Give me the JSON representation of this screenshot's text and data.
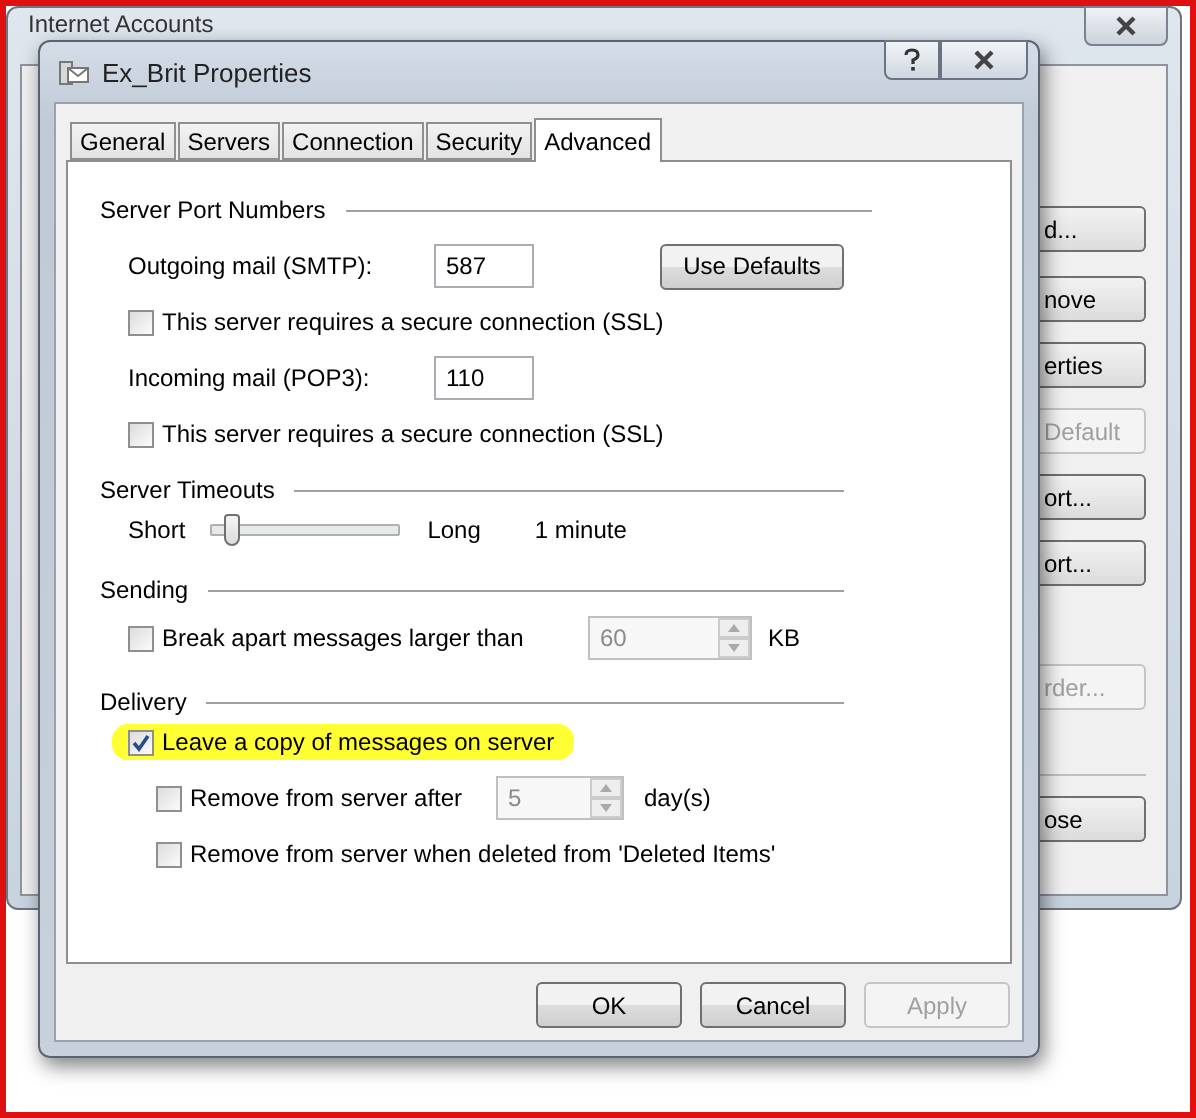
{
  "background_window": {
    "title": "Internet Accounts",
    "buttons": [
      {
        "label": "d...",
        "disabled": false
      },
      {
        "label": "nove",
        "disabled": false
      },
      {
        "label": "erties",
        "disabled": false
      },
      {
        "label": "Default",
        "disabled": true
      },
      {
        "label": "ort...",
        "disabled": false
      },
      {
        "label": "ort...",
        "disabled": false
      },
      {
        "label": "rder...",
        "disabled": true
      },
      {
        "label": "ose",
        "disabled": false
      }
    ]
  },
  "dialog": {
    "title": "Ex_Brit Properties",
    "tabs": [
      {
        "label": "General",
        "selected": false
      },
      {
        "label": "Servers",
        "selected": false
      },
      {
        "label": "Connection",
        "selected": false
      },
      {
        "label": "Security",
        "selected": false
      },
      {
        "label": "Advanced",
        "selected": true
      }
    ],
    "server_ports": {
      "heading": "Server Port Numbers",
      "outgoing": {
        "label": "Outgoing mail (SMTP):",
        "value": "587"
      },
      "use_defaults": "Use Defaults",
      "outgoing_ssl": {
        "label": "This server requires a secure connection (SSL)",
        "checked": false
      },
      "incoming": {
        "label": "Incoming mail (POP3):",
        "value": "110"
      },
      "incoming_ssl": {
        "label": "This server requires a secure connection (SSL)",
        "checked": false
      }
    },
    "server_timeouts": {
      "heading": "Server Timeouts",
      "min_label": "Short",
      "max_label": "Long",
      "level": 0.12,
      "reading": "1 minute"
    },
    "sending": {
      "heading": "Sending",
      "break_apart": {
        "label": "Break apart messages larger than",
        "checked": false
      },
      "size": {
        "value": "60",
        "disabled": true
      },
      "unit": "KB"
    },
    "delivery": {
      "heading": "Delivery",
      "leave_copy": {
        "label": "Leave a copy of messages on server",
        "checked": true,
        "highlighted": true
      },
      "remove_after": {
        "label": "Remove from server after",
        "checked": false
      },
      "days": {
        "value": "5",
        "disabled": true
      },
      "days_unit": "day(s)",
      "remove_deleted": {
        "label": "Remove from server when deleted from 'Deleted Items'",
        "checked": false
      }
    },
    "buttons": [
      {
        "label": "OK",
        "disabled": false
      },
      {
        "label": "Cancel",
        "disabled": false
      },
      {
        "label": "Apply",
        "disabled": true
      }
    ]
  }
}
